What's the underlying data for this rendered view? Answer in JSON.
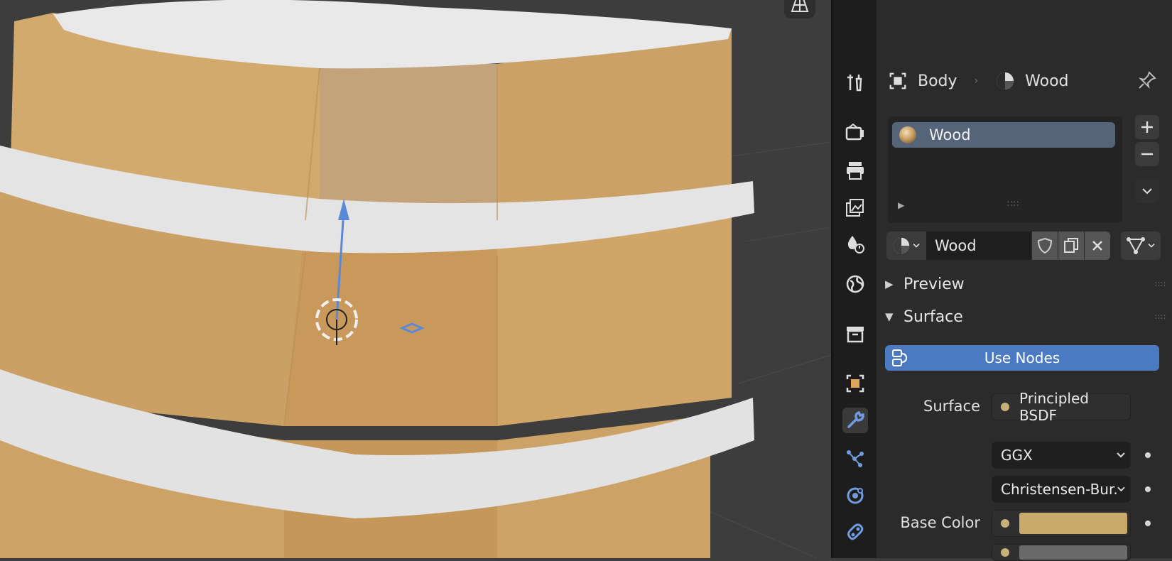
{
  "header": {
    "editor_type_icon": "properties-editor-icon",
    "search_placeholder": ""
  },
  "breadcrumb": {
    "object": "Body",
    "material": "Wood"
  },
  "material_slots": [
    {
      "name": "Wood",
      "selected": true
    }
  ],
  "material_slot": {
    "name": "Wood"
  },
  "panels": {
    "preview": "Preview",
    "surface": "Surface"
  },
  "use_nodes_label": "Use Nodes",
  "properties": {
    "surface_label": "Surface",
    "surface_value": "Principled BSDF",
    "distribution_value": "GGX",
    "subsurface_method_value": "Christensen-Bur...",
    "base_color_label": "Base Color"
  },
  "tabs": [
    "tool-icon",
    "render-icon",
    "output-icon",
    "view-layer-icon",
    "scene-icon",
    "world-icon",
    "collection-icon",
    "object-icon",
    "modifier-icon",
    "particles-icon",
    "physics-icon",
    "constraints-icon"
  ],
  "colors": {
    "accent": "#4b79c2",
    "base_color": "#c9a96c",
    "barrel_wood": "#d7ac6e",
    "barrel_band": "#e4e4e4"
  }
}
